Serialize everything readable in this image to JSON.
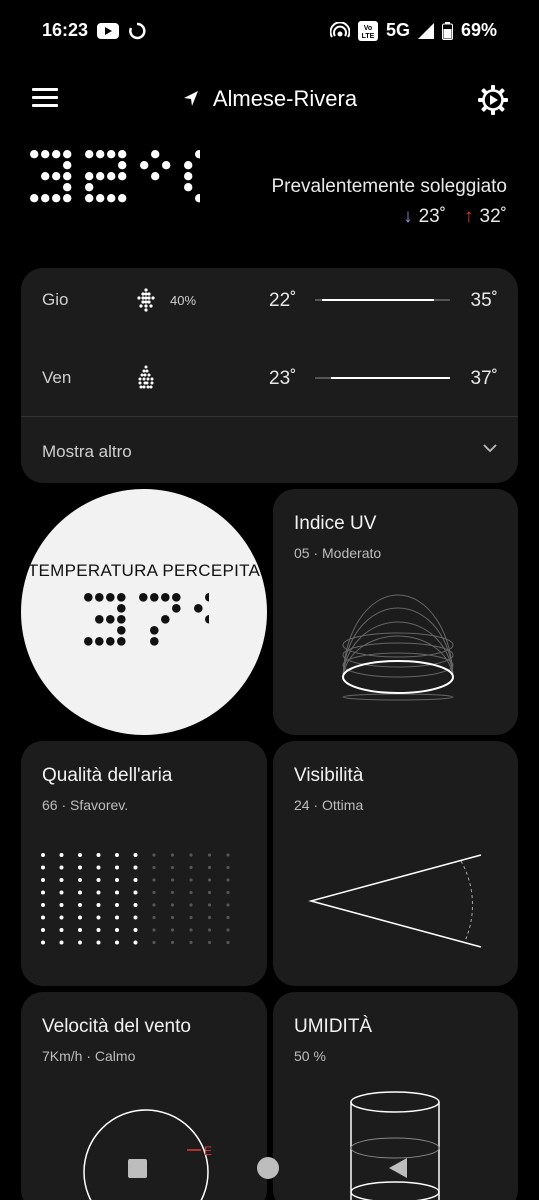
{
  "status_bar": {
    "time": "16:23",
    "network": "5G",
    "battery": "69%",
    "volte": "Vo LTE"
  },
  "header": {
    "location": "Almese-Rivera"
  },
  "current": {
    "temperature": "32°C",
    "condition": "Prevalentemente soleggiato",
    "low": "23˚",
    "high": "32˚"
  },
  "forecast": {
    "days": [
      {
        "day": "Gio",
        "icon": "rain-drops-icon",
        "precip": "40%",
        "low": "22˚",
        "high": "35˚",
        "range_start": 0.05,
        "range_end": 0.88
      },
      {
        "day": "Ven",
        "icon": "flame-icon",
        "precip": "",
        "low": "23˚",
        "high": "37˚",
        "range_start": 0.12,
        "range_end": 1.0
      }
    ],
    "show_more": "Mostra altro"
  },
  "tiles": {
    "feels_like": {
      "title": "TEMPERATURA PERCEPITA",
      "value": "37°"
    },
    "uv": {
      "title": "Indice UV",
      "subtitle": "05 · Moderato"
    },
    "air": {
      "title": "Qualità dell'aria",
      "subtitle": "66 · Sfavorev."
    },
    "visibility": {
      "title": "Visibilità",
      "subtitle": "24 · Ottima"
    },
    "wind": {
      "title": "Velocità del vento",
      "subtitle": "7Km/h · Calmo",
      "direction": "E"
    },
    "humidity": {
      "title": "UMIDITÀ",
      "subtitle": "50 %"
    }
  },
  "colors": {
    "background": "#000000",
    "card": "#1c1c1c",
    "low_arrow": "#8f98d8",
    "high_arrow": "#e03838",
    "wind_marker": "#e03838"
  }
}
